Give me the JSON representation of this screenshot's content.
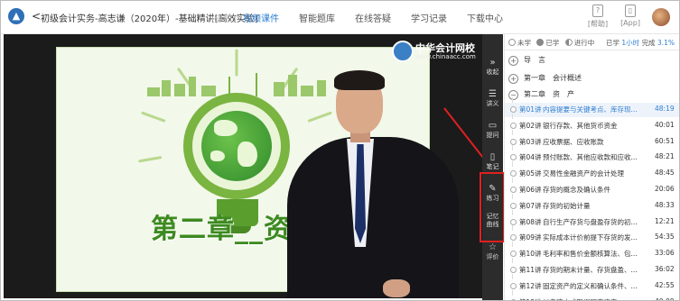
{
  "header": {
    "back_symbol": "<",
    "course_title": "初级会计实务-高志谦（2020年）-基础精讲[高效实验]",
    "course_status": "(进阶)",
    "nav": [
      {
        "label": "视频课件",
        "active": true
      },
      {
        "label": "智能题库",
        "active": false
      },
      {
        "label": "在线答疑",
        "active": false
      },
      {
        "label": "学习记录",
        "active": false
      },
      {
        "label": "下载中心",
        "active": false
      }
    ],
    "help_label": "[帮助]",
    "app_label": "[App]"
  },
  "video": {
    "slide_title": "第二章__资",
    "brand_name": "中华会计网校",
    "brand_url": "www.chinaacc.com"
  },
  "toolbar": [
    {
      "name": "collapse",
      "icon": "»",
      "label": "收起"
    },
    {
      "name": "handout",
      "icon": "☰",
      "label": "讲义"
    },
    {
      "name": "question",
      "icon": "▭",
      "label": "提问"
    },
    {
      "name": "notes",
      "icon": "▯",
      "label": "笔记"
    },
    {
      "name": "practice",
      "icon": "✎",
      "label": "练习"
    },
    {
      "name": "memory-curve",
      "icon": "",
      "label": "记忆曲线"
    },
    {
      "name": "rate",
      "icon": "☆",
      "label": "评价"
    }
  ],
  "panel": {
    "legend": {
      "unlearned": "未学",
      "learned": "已学",
      "in_progress": "进行中"
    },
    "study_prefix": "已学",
    "study_time": "1小时",
    "done_prefix": "完成",
    "done_percent": "3.1%",
    "sections": [
      {
        "label": "导　言",
        "symbol": "+"
      },
      {
        "label": "第一章　会计概述",
        "symbol": "+"
      },
      {
        "label": "第二章　资　产",
        "symbol": "−"
      }
    ],
    "lessons": [
      {
        "num": "第01讲",
        "title": "内容提要与关键考点、库存现...",
        "duration": "48:19",
        "active": true
      },
      {
        "num": "第02讲",
        "title": "银行存款、其他货币资金",
        "duration": "40:01",
        "active": false
      },
      {
        "num": "第03讲",
        "title": "应收票据、应收账款",
        "duration": "60:51",
        "active": false
      },
      {
        "num": "第04讲",
        "title": "预付账款、其他应收款和应收...",
        "duration": "48:21",
        "active": false
      },
      {
        "num": "第05讲",
        "title": "交易性金融资产的会计处理",
        "duration": "48:45",
        "active": false
      },
      {
        "num": "第06讲",
        "title": "存货的概念及确认条件",
        "duration": "20:06",
        "active": false
      },
      {
        "num": "第07讲",
        "title": "存货的初始计量",
        "duration": "48:33",
        "active": false
      },
      {
        "num": "第08讲",
        "title": "自行生产存货与盘盈存货的初...",
        "duration": "12:21",
        "active": false
      },
      {
        "num": "第09讲",
        "title": "实际成本计价前提下存货的发...",
        "duration": "54:35",
        "active": false
      },
      {
        "num": "第10讲",
        "title": "毛利率和售价金额核算法、包...",
        "duration": "33:06",
        "active": false
      },
      {
        "num": "第11讲",
        "title": "存货的期末计量、存货盘盈、...",
        "duration": "36:02",
        "active": false
      },
      {
        "num": "第12讲",
        "title": "固定资产的定义和确认条件、...",
        "duration": "42:55",
        "active": false
      },
      {
        "num": "第13讲",
        "title": "以自建方式取得固定资产",
        "duration": "40:09",
        "active": false
      }
    ]
  }
}
